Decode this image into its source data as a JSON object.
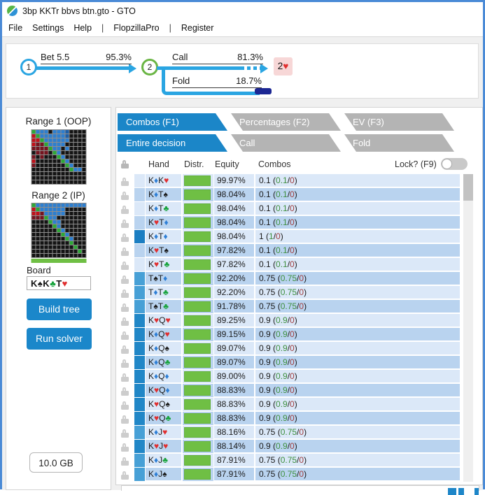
{
  "window": {
    "title": "3bp KKTr bbvs btn.gto - GTO"
  },
  "menu": {
    "items": [
      "File",
      "Settings",
      "Help",
      "|",
      "FlopzillaPro",
      "|",
      "Register"
    ]
  },
  "tree": {
    "node1": "1",
    "node2": "2",
    "edge_bet": {
      "label": "Bet 5.5",
      "pct": "95.3%"
    },
    "edge_call": {
      "label": "Call",
      "pct": "81.3%"
    },
    "edge_fold": {
      "label": "Fold",
      "pct": "18.7%"
    },
    "terminal": {
      "rank": "2",
      "suit": "heart"
    }
  },
  "sidebar": {
    "range1_label": "Range 1 (OOP)",
    "range2_label": "Range 2 (IP)",
    "board_label": "Board",
    "board_cards": [
      {
        "rank": "K",
        "suit": "spade"
      },
      {
        "rank": "K",
        "suit": "club"
      },
      {
        "rank": "T",
        "suit": "heart"
      }
    ],
    "build_tree_label": "Build tree",
    "run_solver_label": "Run solver",
    "memory_label": "10.0 GB",
    "grid1": [
      "GBBBKBBBDKKKK",
      "RGBBBBBBDKKKK",
      "RRGBBBBBBKKKK",
      "RMMGBBBBKKKKK",
      "MMMMGBBKBKKKK",
      "KMMMKGBKKKKKK",
      "MKMKKKGBKKKKK",
      "RKKKKKKGBKKKK",
      "MKKKKKKKGBKKK",
      "KKKKKKKKKGBBK",
      "KKKKKKKKKKKKK",
      "KKKKKKKKKKKKK",
      "KKKKKKKKKKKKK"
    ],
    "grid2": [
      "GBBBBBBBBBBBB",
      "RGBBBBBBKKKKK",
      "RRMBBBBBKKKKK",
      "MMMGBBKKKKKKK",
      "KKKKGBBKKKKKK",
      "KKKKKGBKKKKKK",
      "KKKKKKGBKKKKK",
      "KKKKKKKGBKKKK",
      "KKKKKKKKGBKKK",
      "KKKKKKKKKGKKK",
      "KKKKKKKKKKGKK",
      "KKKKKKKKKKKGK",
      "KKKKKKKKKKKKK"
    ]
  },
  "tabs_primary": [
    {
      "label": "Combos (F1)",
      "active": true
    },
    {
      "label": "Percentages (F2)",
      "active": false
    },
    {
      "label": "EV (F3)",
      "active": false
    }
  ],
  "tabs_secondary": [
    {
      "label": "Entire decision",
      "active": true
    },
    {
      "label": "Call",
      "active": false
    },
    {
      "label": "Fold",
      "active": false
    }
  ],
  "table": {
    "headers": {
      "hand": "Hand",
      "distr": "Distr.",
      "equity": "Equity",
      "combos": "Combos",
      "lock": "Lock? (F9)"
    },
    "rows": [
      {
        "hand": [
          [
            "K",
            "diamond"
          ],
          [
            "K",
            "heart"
          ]
        ],
        "equity": "99.97%",
        "combos": "0.1",
        "c_green": "0.1",
        "c_red": "0",
        "w": "0.1"
      },
      {
        "hand": [
          [
            "K",
            "diamond"
          ],
          [
            "T",
            "spade"
          ]
        ],
        "equity": "98.04%",
        "combos": "0.1",
        "c_green": "0.1",
        "c_red": "0",
        "w": "0.1"
      },
      {
        "hand": [
          [
            "K",
            "diamond"
          ],
          [
            "T",
            "club"
          ]
        ],
        "equity": "98.04%",
        "combos": "0.1",
        "c_green": "0.1",
        "c_red": "0",
        "w": "0.1"
      },
      {
        "hand": [
          [
            "K",
            "heart"
          ],
          [
            "T",
            "diamond"
          ]
        ],
        "equity": "98.04%",
        "combos": "0.1",
        "c_green": "0.1",
        "c_red": "0",
        "w": "0.1"
      },
      {
        "hand": [
          [
            "K",
            "diamond"
          ],
          [
            "T",
            "diamond"
          ]
        ],
        "equity": "98.04%",
        "combos": "1",
        "c_green": "1",
        "c_red": "0",
        "w": "1"
      },
      {
        "hand": [
          [
            "K",
            "heart"
          ],
          [
            "T",
            "spade"
          ]
        ],
        "equity": "97.82%",
        "combos": "0.1",
        "c_green": "0.1",
        "c_red": "0",
        "w": "0.1"
      },
      {
        "hand": [
          [
            "K",
            "heart"
          ],
          [
            "T",
            "club"
          ]
        ],
        "equity": "97.82%",
        "combos": "0.1",
        "c_green": "0.1",
        "c_red": "0",
        "w": "0.1"
      },
      {
        "hand": [
          [
            "T",
            "spade"
          ],
          [
            "T",
            "diamond"
          ]
        ],
        "equity": "92.20%",
        "combos": "0.75",
        "c_green": "0.75",
        "c_red": "0",
        "w": "0.75"
      },
      {
        "hand": [
          [
            "T",
            "diamond"
          ],
          [
            "T",
            "club"
          ]
        ],
        "equity": "92.20%",
        "combos": "0.75",
        "c_green": "0.75",
        "c_red": "0",
        "w": "0.75"
      },
      {
        "hand": [
          [
            "T",
            "spade"
          ],
          [
            "T",
            "club"
          ]
        ],
        "equity": "91.78%",
        "combos": "0.75",
        "c_green": "0.75",
        "c_red": "0",
        "w": "0.75"
      },
      {
        "hand": [
          [
            "K",
            "heart"
          ],
          [
            "Q",
            "heart"
          ]
        ],
        "equity": "89.25%",
        "combos": "0.9",
        "c_green": "0.9",
        "c_red": "0",
        "w": "0.9"
      },
      {
        "hand": [
          [
            "K",
            "diamond"
          ],
          [
            "Q",
            "heart"
          ]
        ],
        "equity": "89.15%",
        "combos": "0.9",
        "c_green": "0.9",
        "c_red": "0",
        "w": "0.9"
      },
      {
        "hand": [
          [
            "K",
            "diamond"
          ],
          [
            "Q",
            "spade"
          ]
        ],
        "equity": "89.07%",
        "combos": "0.9",
        "c_green": "0.9",
        "c_red": "0",
        "w": "0.9"
      },
      {
        "hand": [
          [
            "K",
            "diamond"
          ],
          [
            "Q",
            "club"
          ]
        ],
        "equity": "89.07%",
        "combos": "0.9",
        "c_green": "0.9",
        "c_red": "0",
        "w": "0.9"
      },
      {
        "hand": [
          [
            "K",
            "diamond"
          ],
          [
            "Q",
            "diamond"
          ]
        ],
        "equity": "89.00%",
        "combos": "0.9",
        "c_green": "0.9",
        "c_red": "0",
        "w": "0.9"
      },
      {
        "hand": [
          [
            "K",
            "heart"
          ],
          [
            "Q",
            "diamond"
          ]
        ],
        "equity": "88.83%",
        "combos": "0.9",
        "c_green": "0.9",
        "c_red": "0",
        "w": "0.9"
      },
      {
        "hand": [
          [
            "K",
            "heart"
          ],
          [
            "Q",
            "spade"
          ]
        ],
        "equity": "88.83%",
        "combos": "0.9",
        "c_green": "0.9",
        "c_red": "0",
        "w": "0.9"
      },
      {
        "hand": [
          [
            "K",
            "heart"
          ],
          [
            "Q",
            "club"
          ]
        ],
        "equity": "88.83%",
        "combos": "0.9",
        "c_green": "0.9",
        "c_red": "0",
        "w": "0.9"
      },
      {
        "hand": [
          [
            "K",
            "diamond"
          ],
          [
            "J",
            "heart"
          ]
        ],
        "equity": "88.16%",
        "combos": "0.75",
        "c_green": "0.75",
        "c_red": "0",
        "w": "0.75"
      },
      {
        "hand": [
          [
            "K",
            "heart"
          ],
          [
            "J",
            "heart"
          ]
        ],
        "equity": "88.14%",
        "combos": "0.9",
        "c_green": "0.9",
        "c_red": "0",
        "w": "0.9"
      },
      {
        "hand": [
          [
            "K",
            "diamond"
          ],
          [
            "J",
            "club"
          ]
        ],
        "equity": "87.91%",
        "combos": "0.75",
        "c_green": "0.75",
        "c_red": "0",
        "w": "0.75"
      },
      {
        "hand": [
          [
            "K",
            "diamond"
          ],
          [
            "J",
            "spade"
          ]
        ],
        "equity": "87.91%",
        "combos": "0.75",
        "c_green": "0.75",
        "c_red": "0",
        "w": "0.75"
      }
    ]
  },
  "colors": {
    "accent_blue": "#1b86c8",
    "arrow_blue": "#2aa5e2",
    "node2_green": "#6ab544",
    "terminal_pink": "#f7d7d7",
    "fold_cap_navy": "#1c2793",
    "distr_green": "#6fbf44",
    "row_light": "#dbe8f8",
    "row_dark": "#b9d3ef",
    "combos_green": "#3f8f3f",
    "combos_red": "#a04040",
    "suit_spade": "#1a1a1a",
    "suit_heart": "#e02f2f",
    "suit_diamond": "#2e7fd6",
    "suit_club": "#17a33c",
    "weight_1": "#1b7ec2",
    "weight_0.9": "#2187c7",
    "weight_0.75": "#47a0d6",
    "grid_K": "#141414",
    "grid_B": "#2d7fd0",
    "grid_D": "#1d5fa8",
    "grid_R": "#c0111a",
    "grid_M": "#76141f",
    "grid_G": "#2ea836"
  }
}
